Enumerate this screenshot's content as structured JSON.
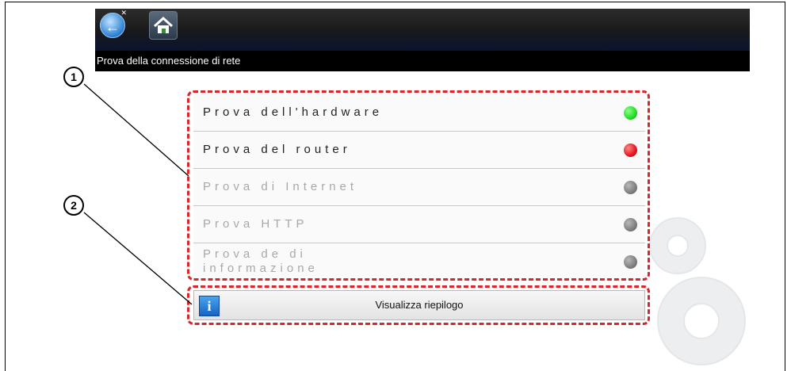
{
  "toolbar": {
    "back_icon": "back-arrow-icon",
    "home_icon": "home-icon"
  },
  "title": "Prova della connessione di rete",
  "tests": [
    {
      "label": "Prova dell'hardware",
      "status_color": "#22dd22",
      "enabled": true
    },
    {
      "label": "Prova del router",
      "status_color": "#e8141b",
      "enabled": true
    },
    {
      "label": "Prova di Internet",
      "status_color": "#7f7f7f",
      "enabled": false
    },
    {
      "label": "Prova HTTP",
      "status_color": "#7f7f7f",
      "enabled": false
    },
    {
      "label": "Prova de                  di\ninformazione",
      "status_color": "#7f7f7f",
      "enabled": false
    }
  ],
  "summary_button": {
    "label": "Visualizza riepilogo",
    "icon": "info-icon"
  },
  "callouts": {
    "one": "1",
    "two": "2"
  },
  "colors": {
    "highlight": "#d9262b",
    "status_pass": "#22dd22",
    "status_fail": "#e8141b",
    "status_pending": "#7f7f7f"
  }
}
